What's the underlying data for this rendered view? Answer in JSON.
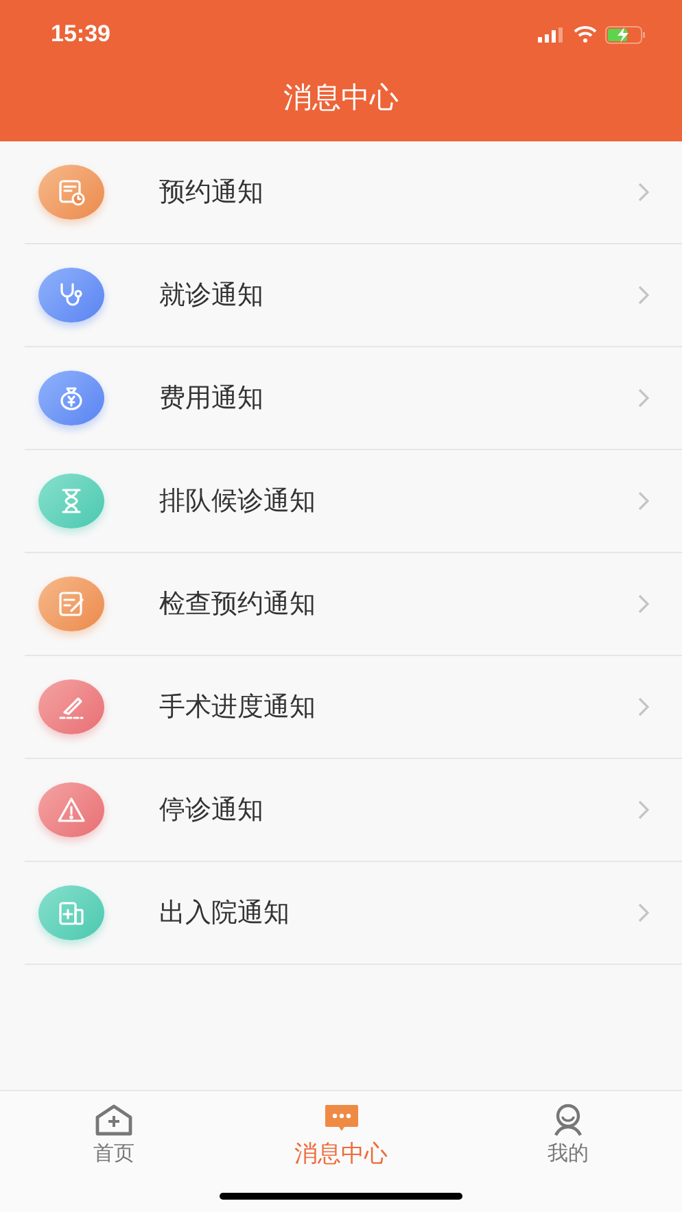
{
  "status_bar": {
    "time": "15:39"
  },
  "header": {
    "title": "消息中心"
  },
  "items": [
    {
      "label": "预约通知",
      "kind": "appointment"
    },
    {
      "label": "就诊通知",
      "kind": "visit"
    },
    {
      "label": "费用通知",
      "kind": "fee"
    },
    {
      "label": "排队候诊通知",
      "kind": "queue"
    },
    {
      "label": "检查预约通知",
      "kind": "exam"
    },
    {
      "label": "手术进度通知",
      "kind": "surgery"
    },
    {
      "label": "停诊通知",
      "kind": "suspend"
    },
    {
      "label": "出入院通知",
      "kind": "admission"
    }
  ],
  "tab_bar": [
    {
      "label": "首页",
      "kind": "home",
      "selected": false
    },
    {
      "label": "消息中心",
      "kind": "message",
      "selected": true
    },
    {
      "label": "我的",
      "kind": "profile",
      "selected": false
    }
  ]
}
